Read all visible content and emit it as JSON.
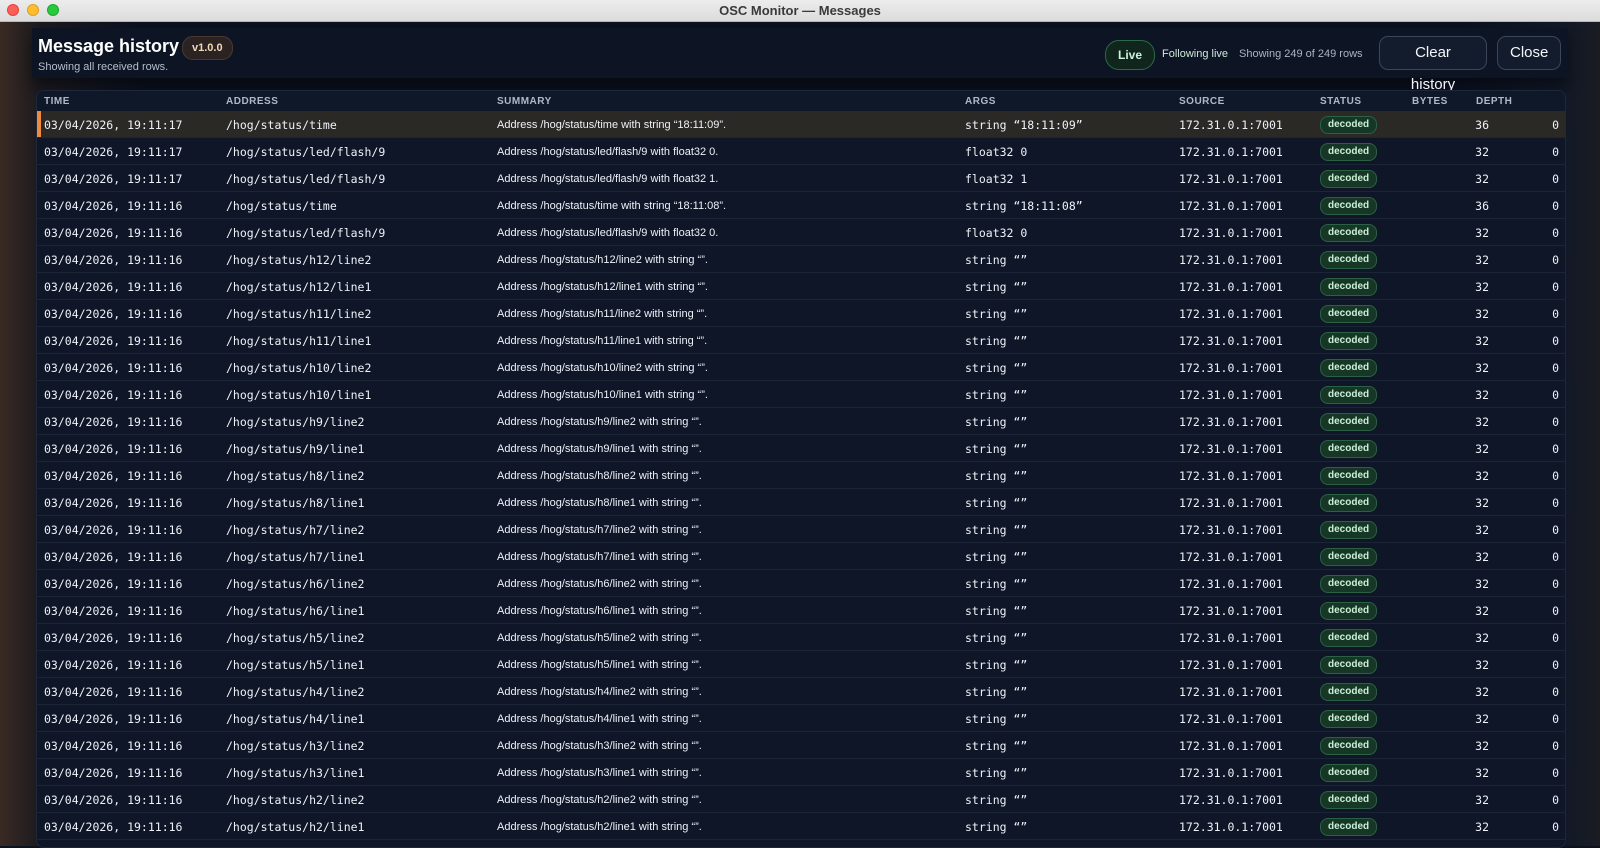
{
  "window": {
    "title": "OSC Monitor — Messages"
  },
  "header": {
    "title": "Message history",
    "version": "v1.0.0",
    "subtitle": "Showing all received rows.",
    "live_label": "Live",
    "following": "Following live",
    "showing": "Showing 249 of 249 rows",
    "clear_label": "Clear history",
    "close_label": "Close"
  },
  "columns": {
    "time": "TIME",
    "address": "ADDRESS",
    "summary": "SUMMARY",
    "args": "ARGS",
    "source": "SOURCE",
    "status": "STATUS",
    "bytes": "BYTES",
    "depth": "DEPTH"
  },
  "rows": [
    {
      "time": "03/04/2026, 19:11:17",
      "address": "/hog/status/time",
      "summary": "Address /hog/status/time with string “18:11:09”.",
      "args": "string “18:11:09”",
      "source": "172.31.0.1:7001",
      "status": "decoded",
      "bytes": "36",
      "depth": "0",
      "selected": true
    },
    {
      "time": "03/04/2026, 19:11:17",
      "address": "/hog/status/led/flash/9",
      "summary": "Address /hog/status/led/flash/9 with float32 0.",
      "args": "float32 0",
      "source": "172.31.0.1:7001",
      "status": "decoded",
      "bytes": "32",
      "depth": "0"
    },
    {
      "time": "03/04/2026, 19:11:17",
      "address": "/hog/status/led/flash/9",
      "summary": "Address /hog/status/led/flash/9 with float32 1.",
      "args": "float32 1",
      "source": "172.31.0.1:7001",
      "status": "decoded",
      "bytes": "32",
      "depth": "0"
    },
    {
      "time": "03/04/2026, 19:11:16",
      "address": "/hog/status/time",
      "summary": "Address /hog/status/time with string “18:11:08”.",
      "args": "string “18:11:08”",
      "source": "172.31.0.1:7001",
      "status": "decoded",
      "bytes": "36",
      "depth": "0"
    },
    {
      "time": "03/04/2026, 19:11:16",
      "address": "/hog/status/led/flash/9",
      "summary": "Address /hog/status/led/flash/9 with float32 0.",
      "args": "float32 0",
      "source": "172.31.0.1:7001",
      "status": "decoded",
      "bytes": "32",
      "depth": "0"
    },
    {
      "time": "03/04/2026, 19:11:16",
      "address": "/hog/status/h12/line2",
      "summary": "Address /hog/status/h12/line2 with string “”.",
      "args": "string “”",
      "source": "172.31.0.1:7001",
      "status": "decoded",
      "bytes": "32",
      "depth": "0"
    },
    {
      "time": "03/04/2026, 19:11:16",
      "address": "/hog/status/h12/line1",
      "summary": "Address /hog/status/h12/line1 with string “”.",
      "args": "string “”",
      "source": "172.31.0.1:7001",
      "status": "decoded",
      "bytes": "32",
      "depth": "0"
    },
    {
      "time": "03/04/2026, 19:11:16",
      "address": "/hog/status/h11/line2",
      "summary": "Address /hog/status/h11/line2 with string “”.",
      "args": "string “”",
      "source": "172.31.0.1:7001",
      "status": "decoded",
      "bytes": "32",
      "depth": "0"
    },
    {
      "time": "03/04/2026, 19:11:16",
      "address": "/hog/status/h11/line1",
      "summary": "Address /hog/status/h11/line1 with string “”.",
      "args": "string “”",
      "source": "172.31.0.1:7001",
      "status": "decoded",
      "bytes": "32",
      "depth": "0"
    },
    {
      "time": "03/04/2026, 19:11:16",
      "address": "/hog/status/h10/line2",
      "summary": "Address /hog/status/h10/line2 with string “”.",
      "args": "string “”",
      "source": "172.31.0.1:7001",
      "status": "decoded",
      "bytes": "32",
      "depth": "0"
    },
    {
      "time": "03/04/2026, 19:11:16",
      "address": "/hog/status/h10/line1",
      "summary": "Address /hog/status/h10/line1 with string “”.",
      "args": "string “”",
      "source": "172.31.0.1:7001",
      "status": "decoded",
      "bytes": "32",
      "depth": "0"
    },
    {
      "time": "03/04/2026, 19:11:16",
      "address": "/hog/status/h9/line2",
      "summary": "Address /hog/status/h9/line2 with string “”.",
      "args": "string “”",
      "source": "172.31.0.1:7001",
      "status": "decoded",
      "bytes": "32",
      "depth": "0"
    },
    {
      "time": "03/04/2026, 19:11:16",
      "address": "/hog/status/h9/line1",
      "summary": "Address /hog/status/h9/line1 with string “”.",
      "args": "string “”",
      "source": "172.31.0.1:7001",
      "status": "decoded",
      "bytes": "32",
      "depth": "0"
    },
    {
      "time": "03/04/2026, 19:11:16",
      "address": "/hog/status/h8/line2",
      "summary": "Address /hog/status/h8/line2 with string “”.",
      "args": "string “”",
      "source": "172.31.0.1:7001",
      "status": "decoded",
      "bytes": "32",
      "depth": "0"
    },
    {
      "time": "03/04/2026, 19:11:16",
      "address": "/hog/status/h8/line1",
      "summary": "Address /hog/status/h8/line1 with string “”.",
      "args": "string “”",
      "source": "172.31.0.1:7001",
      "status": "decoded",
      "bytes": "32",
      "depth": "0"
    },
    {
      "time": "03/04/2026, 19:11:16",
      "address": "/hog/status/h7/line2",
      "summary": "Address /hog/status/h7/line2 with string “”.",
      "args": "string “”",
      "source": "172.31.0.1:7001",
      "status": "decoded",
      "bytes": "32",
      "depth": "0"
    },
    {
      "time": "03/04/2026, 19:11:16",
      "address": "/hog/status/h7/line1",
      "summary": "Address /hog/status/h7/line1 with string “”.",
      "args": "string “”",
      "source": "172.31.0.1:7001",
      "status": "decoded",
      "bytes": "32",
      "depth": "0"
    },
    {
      "time": "03/04/2026, 19:11:16",
      "address": "/hog/status/h6/line2",
      "summary": "Address /hog/status/h6/line2 with string “”.",
      "args": "string “”",
      "source": "172.31.0.1:7001",
      "status": "decoded",
      "bytes": "32",
      "depth": "0"
    },
    {
      "time": "03/04/2026, 19:11:16",
      "address": "/hog/status/h6/line1",
      "summary": "Address /hog/status/h6/line1 with string “”.",
      "args": "string “”",
      "source": "172.31.0.1:7001",
      "status": "decoded",
      "bytes": "32",
      "depth": "0"
    },
    {
      "time": "03/04/2026, 19:11:16",
      "address": "/hog/status/h5/line2",
      "summary": "Address /hog/status/h5/line2 with string “”.",
      "args": "string “”",
      "source": "172.31.0.1:7001",
      "status": "decoded",
      "bytes": "32",
      "depth": "0"
    },
    {
      "time": "03/04/2026, 19:11:16",
      "address": "/hog/status/h5/line1",
      "summary": "Address /hog/status/h5/line1 with string “”.",
      "args": "string “”",
      "source": "172.31.0.1:7001",
      "status": "decoded",
      "bytes": "32",
      "depth": "0"
    },
    {
      "time": "03/04/2026, 19:11:16",
      "address": "/hog/status/h4/line2",
      "summary": "Address /hog/status/h4/line2 with string “”.",
      "args": "string “”",
      "source": "172.31.0.1:7001",
      "status": "decoded",
      "bytes": "32",
      "depth": "0"
    },
    {
      "time": "03/04/2026, 19:11:16",
      "address": "/hog/status/h4/line1",
      "summary": "Address /hog/status/h4/line1 with string “”.",
      "args": "string “”",
      "source": "172.31.0.1:7001",
      "status": "decoded",
      "bytes": "32",
      "depth": "0"
    },
    {
      "time": "03/04/2026, 19:11:16",
      "address": "/hog/status/h3/line2",
      "summary": "Address /hog/status/h3/line2 with string “”.",
      "args": "string “”",
      "source": "172.31.0.1:7001",
      "status": "decoded",
      "bytes": "32",
      "depth": "0"
    },
    {
      "time": "03/04/2026, 19:11:16",
      "address": "/hog/status/h3/line1",
      "summary": "Address /hog/status/h3/line1 with string “”.",
      "args": "string “”",
      "source": "172.31.0.1:7001",
      "status": "decoded",
      "bytes": "32",
      "depth": "0"
    },
    {
      "time": "03/04/2026, 19:11:16",
      "address": "/hog/status/h2/line2",
      "summary": "Address /hog/status/h2/line2 with string “”.",
      "args": "string “”",
      "source": "172.31.0.1:7001",
      "status": "decoded",
      "bytes": "32",
      "depth": "0"
    },
    {
      "time": "03/04/2026, 19:11:16",
      "address": "/hog/status/h2/line1",
      "summary": "Address /hog/status/h2/line1 with string “”.",
      "args": "string “”",
      "source": "172.31.0.1:7001",
      "status": "decoded",
      "bytes": "32",
      "depth": "0"
    }
  ],
  "colors": {
    "accent_selected": "#f08a3c",
    "status_decoded": "#173726",
    "live": "#10261d"
  }
}
